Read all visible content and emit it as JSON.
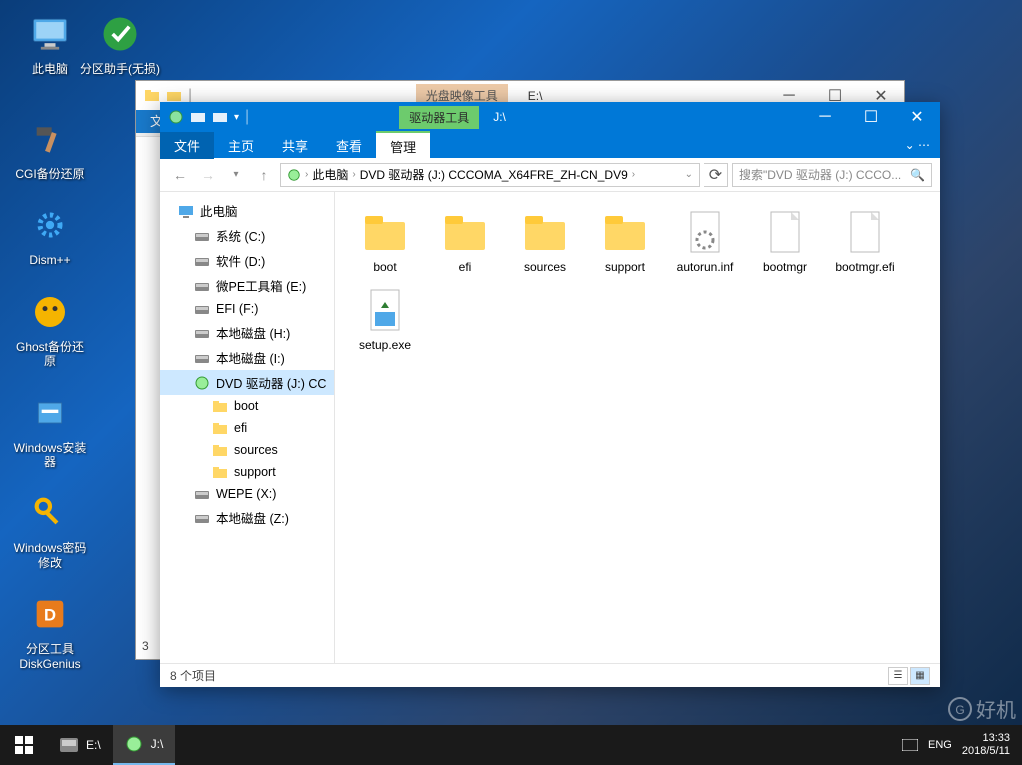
{
  "desktop": [
    {
      "label": "此电脑",
      "icon": "computer"
    },
    {
      "label": "分区助手(无损)",
      "icon": "partition"
    },
    {
      "label": "CGI备份还原",
      "icon": "cgi"
    },
    {
      "label": "Dism++",
      "icon": "dism"
    },
    {
      "label": "Ghost备份还原",
      "icon": "ghost"
    },
    {
      "label": "Windows安装器",
      "icon": "wininst"
    },
    {
      "label": "Windows密码修改",
      "icon": "key"
    },
    {
      "label": "分区工具DiskGenius",
      "icon": "diskgenius"
    }
  ],
  "bg_window": {
    "context_tab": "光盘映像工具",
    "path": "E:\\",
    "visible_number": "3"
  },
  "fg_window": {
    "context_tab": "驱动器工具",
    "title_path": "J:\\",
    "ribbon": {
      "file": "文件",
      "home": "主页",
      "share": "共享",
      "view": "查看",
      "manage": "管理"
    },
    "breadcrumb": [
      "此电脑",
      "DVD 驱动器 (J:) CCCOMA_X64FRE_ZH-CN_DV9"
    ],
    "search_placeholder": "搜索\"DVD 驱动器 (J:) CCCO...",
    "nav": {
      "root": "此电脑",
      "drives": [
        {
          "label": "系统 (C:)",
          "type": "disk"
        },
        {
          "label": "软件 (D:)",
          "type": "disk"
        },
        {
          "label": "微PE工具箱 (E:)",
          "type": "disk"
        },
        {
          "label": "EFI (F:)",
          "type": "disk"
        },
        {
          "label": "本地磁盘 (H:)",
          "type": "disk"
        },
        {
          "label": "本地磁盘 (I:)",
          "type": "disk"
        },
        {
          "label": "DVD 驱动器 (J:) CC",
          "type": "dvd",
          "selected": true,
          "children": [
            "boot",
            "efi",
            "sources",
            "support"
          ]
        },
        {
          "label": "WEPE (X:)",
          "type": "disk"
        },
        {
          "label": "本地磁盘 (Z:)",
          "type": "disk"
        }
      ]
    },
    "files": [
      {
        "name": "boot",
        "type": "folder"
      },
      {
        "name": "efi",
        "type": "folder"
      },
      {
        "name": "sources",
        "type": "folder"
      },
      {
        "name": "support",
        "type": "folder"
      },
      {
        "name": "autorun.inf",
        "type": "inf"
      },
      {
        "name": "bootmgr",
        "type": "file"
      },
      {
        "name": "bootmgr.efi",
        "type": "file"
      },
      {
        "name": "setup.exe",
        "type": "exe"
      }
    ],
    "status": "8 个项目"
  },
  "taskbar": {
    "items": [
      {
        "label": "E:\\",
        "icon": "disk"
      },
      {
        "label": "J:\\",
        "icon": "dvd",
        "active": true
      }
    ],
    "ime": "ENG",
    "time": "13:33",
    "date": "2018/5/11"
  },
  "watermark": "好机"
}
